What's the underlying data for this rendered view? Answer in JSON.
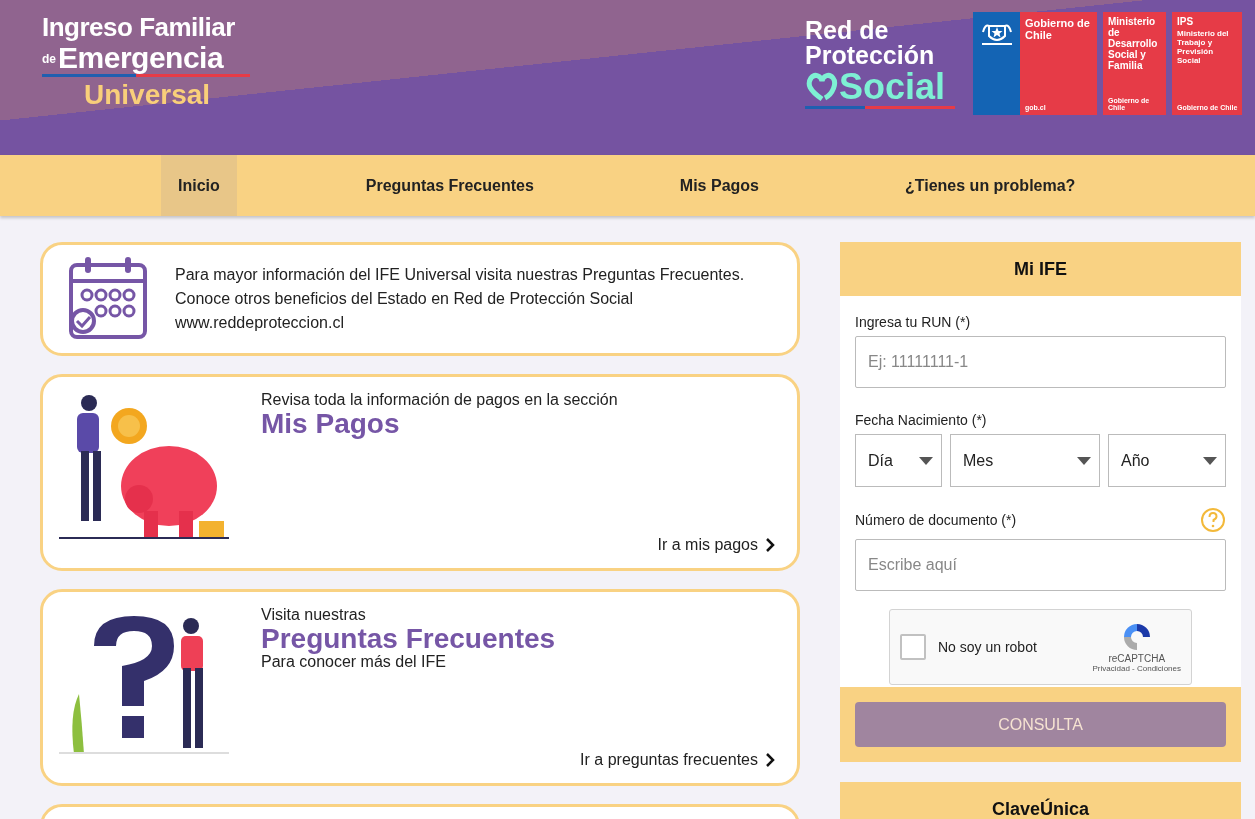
{
  "header": {
    "logo": {
      "line1": "Ingreso Familiar",
      "small": "de",
      "line2": "Emergencia",
      "line3": "Universal"
    },
    "red_logo": {
      "line1": "Red de",
      "line2": "Protección",
      "line3": "Social"
    },
    "gov_logos": [
      {
        "kind": "gobierno",
        "title": "Gobierno de Chile",
        "footer": "gob.cl"
      },
      {
        "kind": "ministry",
        "title": "Ministerio de Desarrollo Social y Familia",
        "footer": "Gobierno de Chile"
      },
      {
        "kind": "ips",
        "title": "IPS",
        "subtitle": "Ministerio del Trabajo y Previsión Social",
        "footer": "Gobierno de Chile"
      }
    ]
  },
  "nav": [
    {
      "label": "Inicio",
      "selected": true
    },
    {
      "label": "Preguntas Frecuentes",
      "selected": false
    },
    {
      "label": "Mis Pagos",
      "selected": false
    },
    {
      "label": "¿Tienes un problema?",
      "selected": false
    }
  ],
  "info_card": {
    "text": "Para mayor información del IFE Universal visita nuestras Preguntas Frecuentes. Conoce otros beneficios del Estado en Red de Protección Social www.reddeproteccion.cl"
  },
  "cards": [
    {
      "kind": "pagos",
      "intro": "Revisa toda la información de pagos en la sección",
      "title": "Mis Pagos",
      "link": "Ir a mis pagos"
    },
    {
      "kind": "preguntas",
      "intro": "Visita nuestras",
      "title": "Preguntas Frecuentes",
      "subtitle": "Para conocer más del IFE",
      "link": "Ir a preguntas frecuentes"
    }
  ],
  "form": {
    "title": "Mi IFE",
    "run_label": "Ingresa tu RUN (*)",
    "run_placeholder": "Ej: 11111111-1",
    "date_label": "Fecha Nacimiento (*)",
    "date_selects": [
      "Día",
      "Mes",
      "Año"
    ],
    "doc_label": "Número de documento (*)",
    "doc_placeholder": "Escribe aquí",
    "captcha": {
      "label": "No soy un robot",
      "checked": false,
      "brand": "reCAPTCHA",
      "links": "Privacidad - Condiciones"
    },
    "button": {
      "label": "CONSULTA",
      "disabled": true
    }
  },
  "clave_panel": {
    "title": "ClaveÚnica"
  }
}
